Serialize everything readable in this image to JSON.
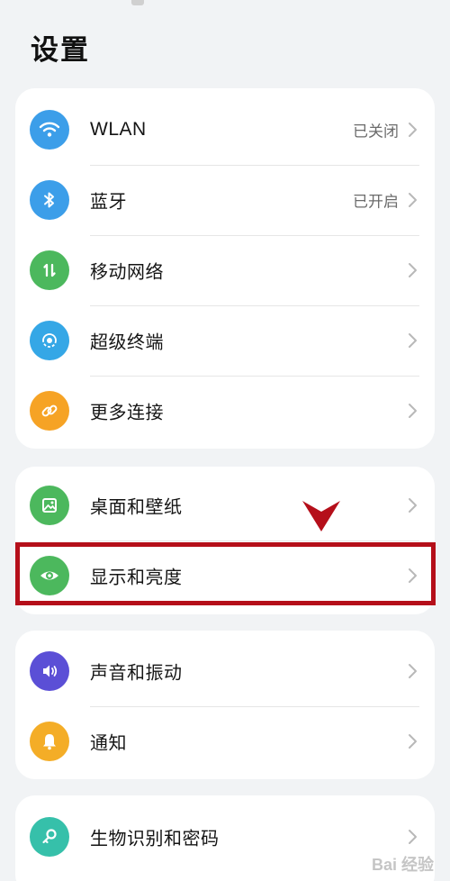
{
  "header": {
    "title": "设置"
  },
  "colors": {
    "background": "#f1f3f5",
    "card": "#ffffff",
    "blue": "#3c9ee9",
    "green": "#4cb85d",
    "cyan": "#35a7e6",
    "orange": "#f6a325",
    "purple": "#5b4fd6",
    "yellow": "#f4ad27",
    "teal": "#36c0aa",
    "highlight": "#b50f1a"
  },
  "groups": [
    {
      "items": [
        {
          "label": "WLAN",
          "value": "已关闭",
          "icon": "wifi-icon",
          "icon_color": "#3c9ee9"
        },
        {
          "label": "蓝牙",
          "value": "已开启",
          "icon": "bluetooth-icon",
          "icon_color": "#3c9ee9"
        },
        {
          "label": "移动网络",
          "value": "",
          "icon": "mobile-data-icon",
          "icon_color": "#4cb85d"
        },
        {
          "label": "超级终端",
          "value": "",
          "icon": "super-device-icon",
          "icon_color": "#35a7e6"
        },
        {
          "label": "更多连接",
          "value": "",
          "icon": "link-icon",
          "icon_color": "#f6a325"
        }
      ]
    },
    {
      "items": [
        {
          "label": "桌面和壁纸",
          "value": "",
          "icon": "wallpaper-icon",
          "icon_color": "#4cb85d"
        },
        {
          "label": "显示和亮度",
          "value": "",
          "icon": "eye-icon",
          "icon_color": "#4cb85d"
        }
      ]
    },
    {
      "items": [
        {
          "label": "声音和振动",
          "value": "",
          "icon": "speaker-icon",
          "icon_color": "#5b4fd6"
        },
        {
          "label": "通知",
          "value": "",
          "icon": "bell-icon",
          "icon_color": "#f4ad27"
        }
      ]
    },
    {
      "items": [
        {
          "label": "生物识别和密码",
          "value": "",
          "icon": "key-icon",
          "icon_color": "#36c0aa"
        }
      ]
    }
  ],
  "watermark": {
    "text": "Bai 经验"
  }
}
